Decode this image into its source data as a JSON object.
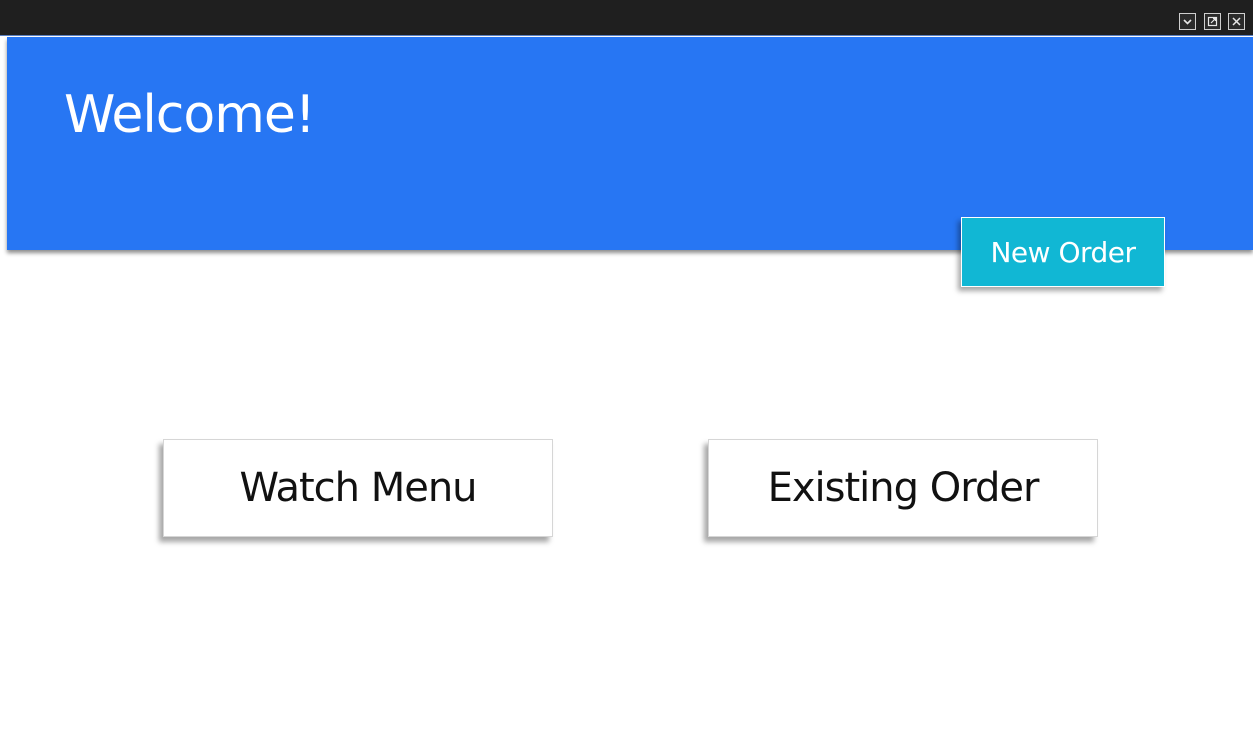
{
  "titlebar": {
    "buttons": [
      {
        "icon": "chevron-down-icon"
      },
      {
        "icon": "popout-icon"
      },
      {
        "icon": "close-icon"
      }
    ]
  },
  "header": {
    "title": "Welcome!",
    "background_color": "#2776f3"
  },
  "actions": {
    "new_order_label": "New Order",
    "new_order_color": "#11b7d4",
    "watch_menu_label": "Watch Menu",
    "existing_order_label": "Existing Order"
  }
}
